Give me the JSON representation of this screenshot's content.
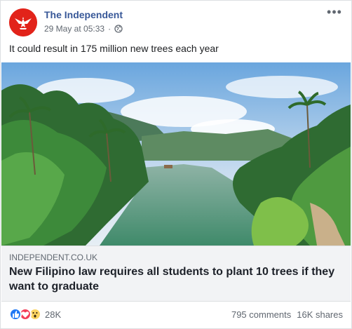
{
  "post": {
    "page_name": "The Independent",
    "timestamp": "29 May at 05:33",
    "audience_icon": "globe-icon",
    "more_icon": "more-options-icon",
    "more_label": "•••",
    "text": "It could result in 175 million new trees each year"
  },
  "link": {
    "domain": "INDEPENDENT.CO.UK",
    "headline": "New Filipino law requires all students to plant 10 trees if they want to graduate"
  },
  "engagement": {
    "reaction_icons": [
      "like-icon",
      "love-icon",
      "wow-icon"
    ],
    "reaction_count": "28K",
    "comments": "795 comments",
    "shares": "16K shares"
  },
  "colors": {
    "brand_red": "#e2231a",
    "link_blue": "#385898",
    "like_blue": "#2078f4",
    "love_red": "#f33e58",
    "wow_yellow": "#fcd462"
  }
}
